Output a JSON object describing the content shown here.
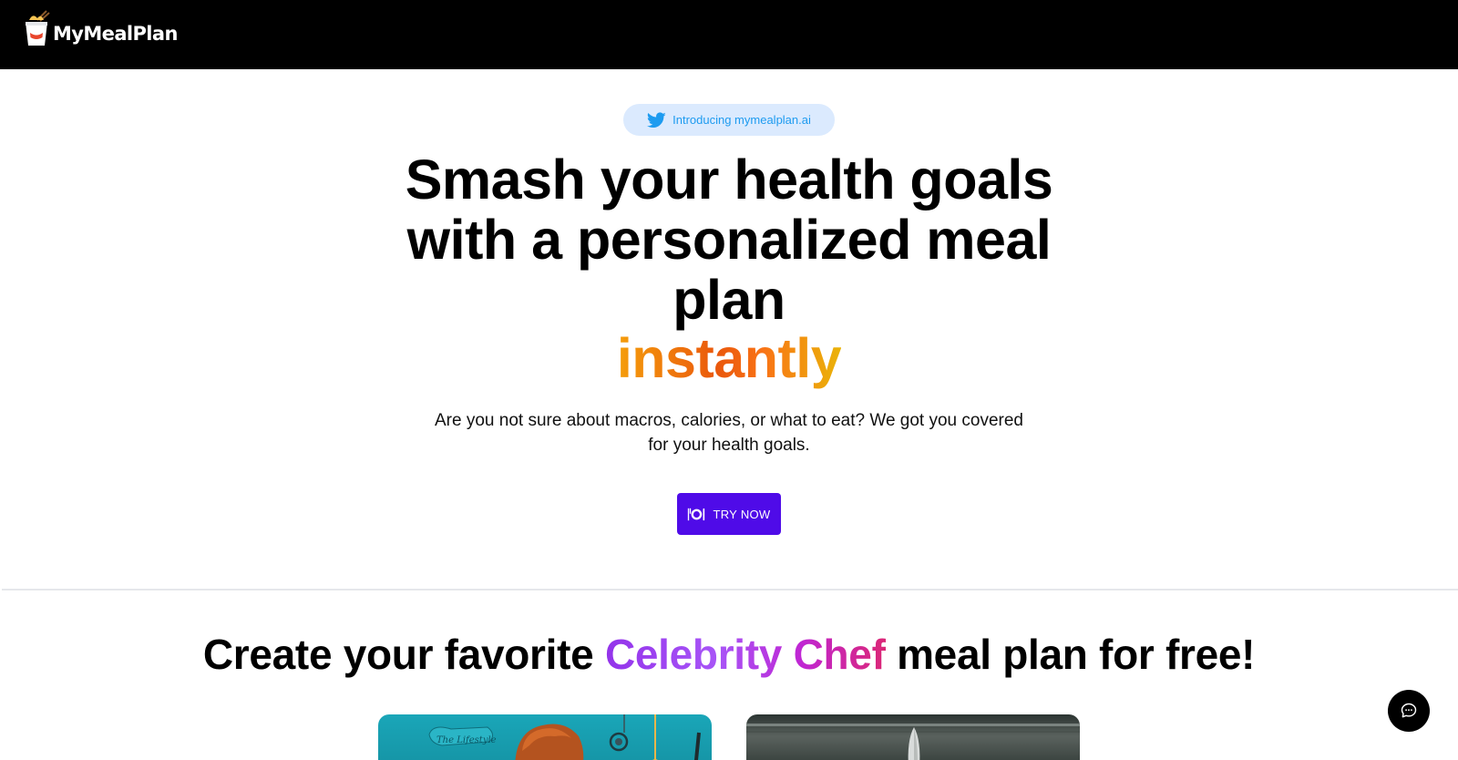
{
  "brand": {
    "name": "MyMealPlan"
  },
  "hero": {
    "announcement": "Introducing mymealplan.ai",
    "headline_lines": [
      "Smash your health goals",
      "with a personalized meal",
      "plan"
    ],
    "highlight": "instantly",
    "subtext": "Are you not sure about macros, calories, or what to eat? We got you covered for your health goals.",
    "cta_label": "TRY NOW"
  },
  "section": {
    "title_before": "Create your favorite",
    "title_highlight": "Celebrity Chef",
    "title_after": "meal plan for free!"
  },
  "cards": [
    {
      "badge": "The Lifestyle"
    },
    {
      "badge": ""
    }
  ],
  "icons": {
    "announcement": "twitter-bird-icon",
    "cta": "plate-cutlery-icon",
    "chat": "chat-bubble-icon",
    "logo": "noodle-box-icon"
  },
  "colors": {
    "topbar": "#000000",
    "pill_bg": "#dbeafe",
    "twitter_blue": "#1d9bf0",
    "cta": "#4f0be8",
    "highlight_gradient": [
      "#f59e0b",
      "#ea580c",
      "#eab308"
    ],
    "chef_gradient": [
      "#9333ea",
      "#db2777"
    ]
  }
}
